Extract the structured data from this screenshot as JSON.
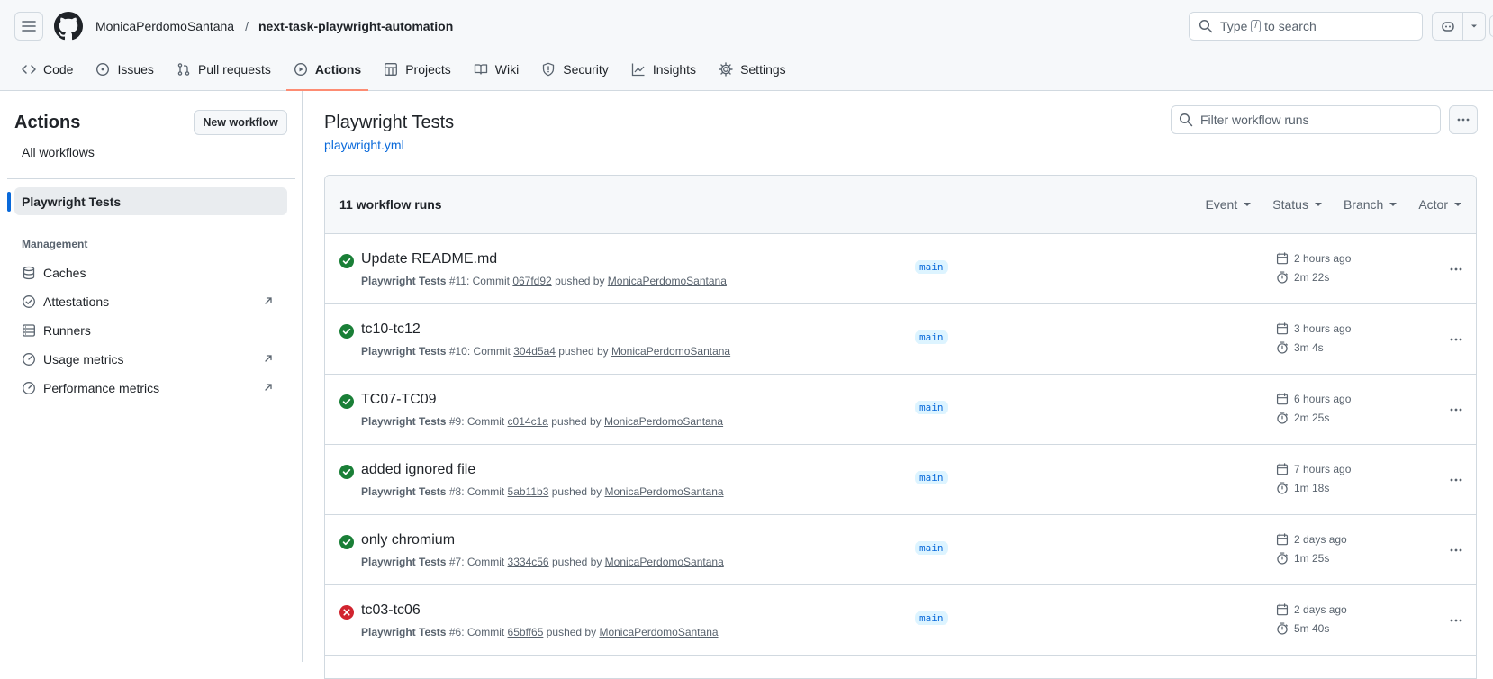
{
  "header": {
    "owner": "MonicaPerdomoSantana",
    "separator": "/",
    "repo": "next-task-playwright-automation",
    "search_prefix": "Type",
    "search_key": "/",
    "search_suffix": "to search"
  },
  "tabs": [
    {
      "label": "Code",
      "icon": "code-icon"
    },
    {
      "label": "Issues",
      "icon": "issue-icon"
    },
    {
      "label": "Pull requests",
      "icon": "pull-request-icon"
    },
    {
      "label": "Actions",
      "icon": "play-icon",
      "active": true
    },
    {
      "label": "Projects",
      "icon": "table-icon"
    },
    {
      "label": "Wiki",
      "icon": "book-icon"
    },
    {
      "label": "Security",
      "icon": "shield-icon"
    },
    {
      "label": "Insights",
      "icon": "graph-icon"
    },
    {
      "label": "Settings",
      "icon": "gear-icon"
    }
  ],
  "sidebar": {
    "title": "Actions",
    "new_workflow": "New workflow",
    "all_workflows": "All workflows",
    "selected_workflow": "Playwright Tests",
    "management_heading": "Management",
    "items": [
      {
        "label": "Caches",
        "icon": "database-icon",
        "external": false
      },
      {
        "label": "Attestations",
        "icon": "verified-icon",
        "external": true
      },
      {
        "label": "Runners",
        "icon": "server-icon",
        "external": false
      },
      {
        "label": "Usage metrics",
        "icon": "meter-icon",
        "external": true
      },
      {
        "label": "Performance metrics",
        "icon": "meter-icon",
        "external": true
      }
    ]
  },
  "main": {
    "title": "Playwright Tests",
    "file": "playwright.yml",
    "filter_placeholder": "Filter workflow runs",
    "run_count": "11 workflow runs",
    "filters": [
      "Event",
      "Status",
      "Branch",
      "Actor"
    ]
  },
  "runs": [
    {
      "title": "Update README.md",
      "workflow": "Playwright Tests",
      "number": "#11",
      "commit": "067fd92",
      "actor": "MonicaPerdomoSantana",
      "branch": "main",
      "when": "2 hours ago",
      "duration": "2m 22s",
      "status": "success"
    },
    {
      "title": "tc10-tc12",
      "workflow": "Playwright Tests",
      "number": "#10",
      "commit": "304d5a4",
      "actor": "MonicaPerdomoSantana",
      "branch": "main",
      "when": "3 hours ago",
      "duration": "3m 4s",
      "status": "success"
    },
    {
      "title": "TC07-TC09",
      "workflow": "Playwright Tests",
      "number": "#9",
      "commit": "c014c1a",
      "actor": "MonicaPerdomoSantana",
      "branch": "main",
      "when": "6 hours ago",
      "duration": "2m 25s",
      "status": "success"
    },
    {
      "title": "added ignored file",
      "workflow": "Playwright Tests",
      "number": "#8",
      "commit": "5ab11b3",
      "actor": "MonicaPerdomoSantana",
      "branch": "main",
      "when": "7 hours ago",
      "duration": "1m 18s",
      "status": "success"
    },
    {
      "title": "only chromium",
      "workflow": "Playwright Tests",
      "number": "#7",
      "commit": "3334c56",
      "actor": "MonicaPerdomoSantana",
      "branch": "main",
      "when": "2 days ago",
      "duration": "1m 25s",
      "status": "success"
    },
    {
      "title": "tc03-tc06",
      "workflow": "Playwright Tests",
      "number": "#6",
      "commit": "65bff65",
      "actor": "MonicaPerdomoSantana",
      "branch": "main",
      "when": "2 days ago",
      "duration": "5m 40s",
      "status": "failure"
    }
  ],
  "strings": {
    "commit_word": "Commit",
    "pushed_by": "pushed by"
  },
  "colors": {
    "accent": "#0969da",
    "success": "#1a7f37",
    "failure": "#d1242f",
    "tab_underline": "#fd8c73"
  }
}
